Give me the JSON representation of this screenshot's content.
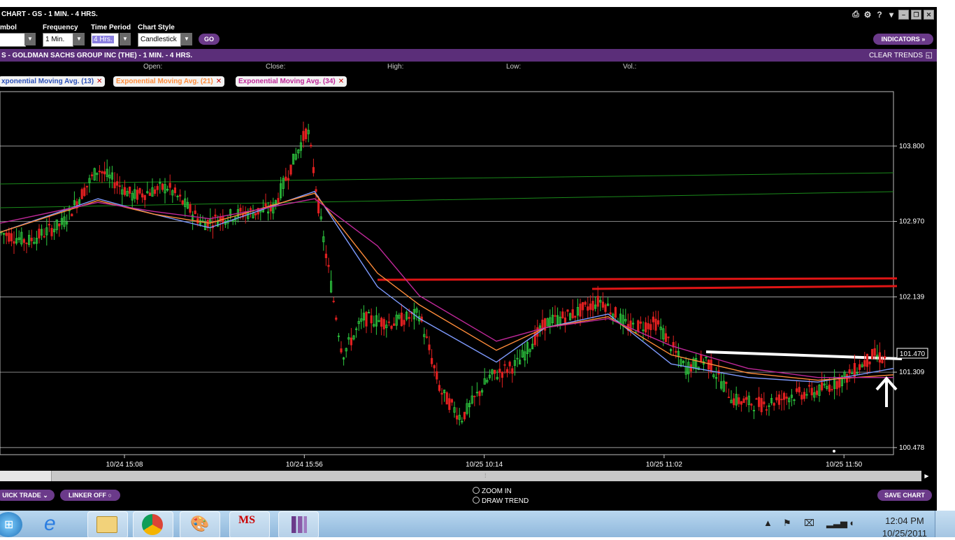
{
  "window": {
    "title": "CHART - GS - 1 MIN. - 4 HRS."
  },
  "toolbar": {
    "symbol_label": "mbol",
    "frequency_label": "Frequency",
    "frequency_value": "1 Min.",
    "period_label": "Time Period",
    "period_value": "4 Hrs.",
    "style_label": "Chart Style",
    "style_value": "Candlestick",
    "go_label": "GO",
    "indicators_label": "INDICATORS"
  },
  "infobar": {
    "title": "S - GOLDMAN SACHS GROUP INC (THE) - 1 MIN. - 4 HRS.",
    "clear_trends_label": "CLEAR TRENDS"
  },
  "ohlc": {
    "open": "Open:",
    "close": "Close:",
    "high": "High:",
    "low": "Low:",
    "vol": "Vol.:"
  },
  "indicators": [
    {
      "label": "xponential Moving Avg. (13)",
      "color": "#2a4fb8"
    },
    {
      "label": "Exponential Moving Avg. (21)",
      "color": "#ff8c3a"
    },
    {
      "label": "Exponential Moving Avg. (34)",
      "color": "#c0289a"
    }
  ],
  "chart_data": {
    "type": "candlestick",
    "y_ticks": [
      "103.800",
      "102.970",
      "102.139",
      "101.309",
      "100.478"
    ],
    "x_ticks": [
      "10/24 15:08",
      "10/24 15:56",
      "10/25 10:14",
      "10/25 11:02",
      "10/25 11:50"
    ],
    "last_price": "101.470",
    "ylim": [
      100.4,
      104.4
    ],
    "colors": {
      "up": "#2ecc40",
      "down": "#e02020",
      "ema13": "#7f9bff",
      "ema21": "#ff8c3a",
      "ema34": "#c0289a",
      "grid": "#d0d0d0",
      "trend_red": "#e01515",
      "trend_green": "#1a8a1a",
      "trend_white": "#ffffff"
    },
    "series": [
      {
        "name": "Exponential Moving Avg. (13)",
        "values": [
          102.85,
          103.22,
          103.05,
          102.9,
          103.3,
          102.25,
          101.9,
          101.42,
          101.8,
          101.95,
          101.4,
          101.25,
          101.2,
          101.35
        ]
      },
      {
        "name": "Exponential Moving Avg. (21)",
        "values": [
          102.85,
          103.2,
          103.05,
          102.95,
          103.28,
          102.4,
          102.05,
          101.55,
          101.8,
          101.92,
          101.5,
          101.3,
          101.22,
          101.28
        ]
      },
      {
        "name": "Exponential Moving Avg. (34)",
        "values": [
          102.95,
          103.18,
          103.08,
          103.0,
          103.22,
          102.7,
          102.15,
          101.65,
          101.8,
          101.9,
          101.6,
          101.35,
          101.25,
          101.25
        ]
      }
    ]
  },
  "bottom": {
    "quick_trade_label": "UICK TRADE",
    "linker_label": "LINKER OFF",
    "zoom_in_label": "ZOOM IN",
    "draw_trend_label": "DRAW TREND",
    "save_chart_label": "SAVE CHART"
  },
  "taskbar": {
    "time": "12:04 PM",
    "date": "10/25/2011"
  }
}
